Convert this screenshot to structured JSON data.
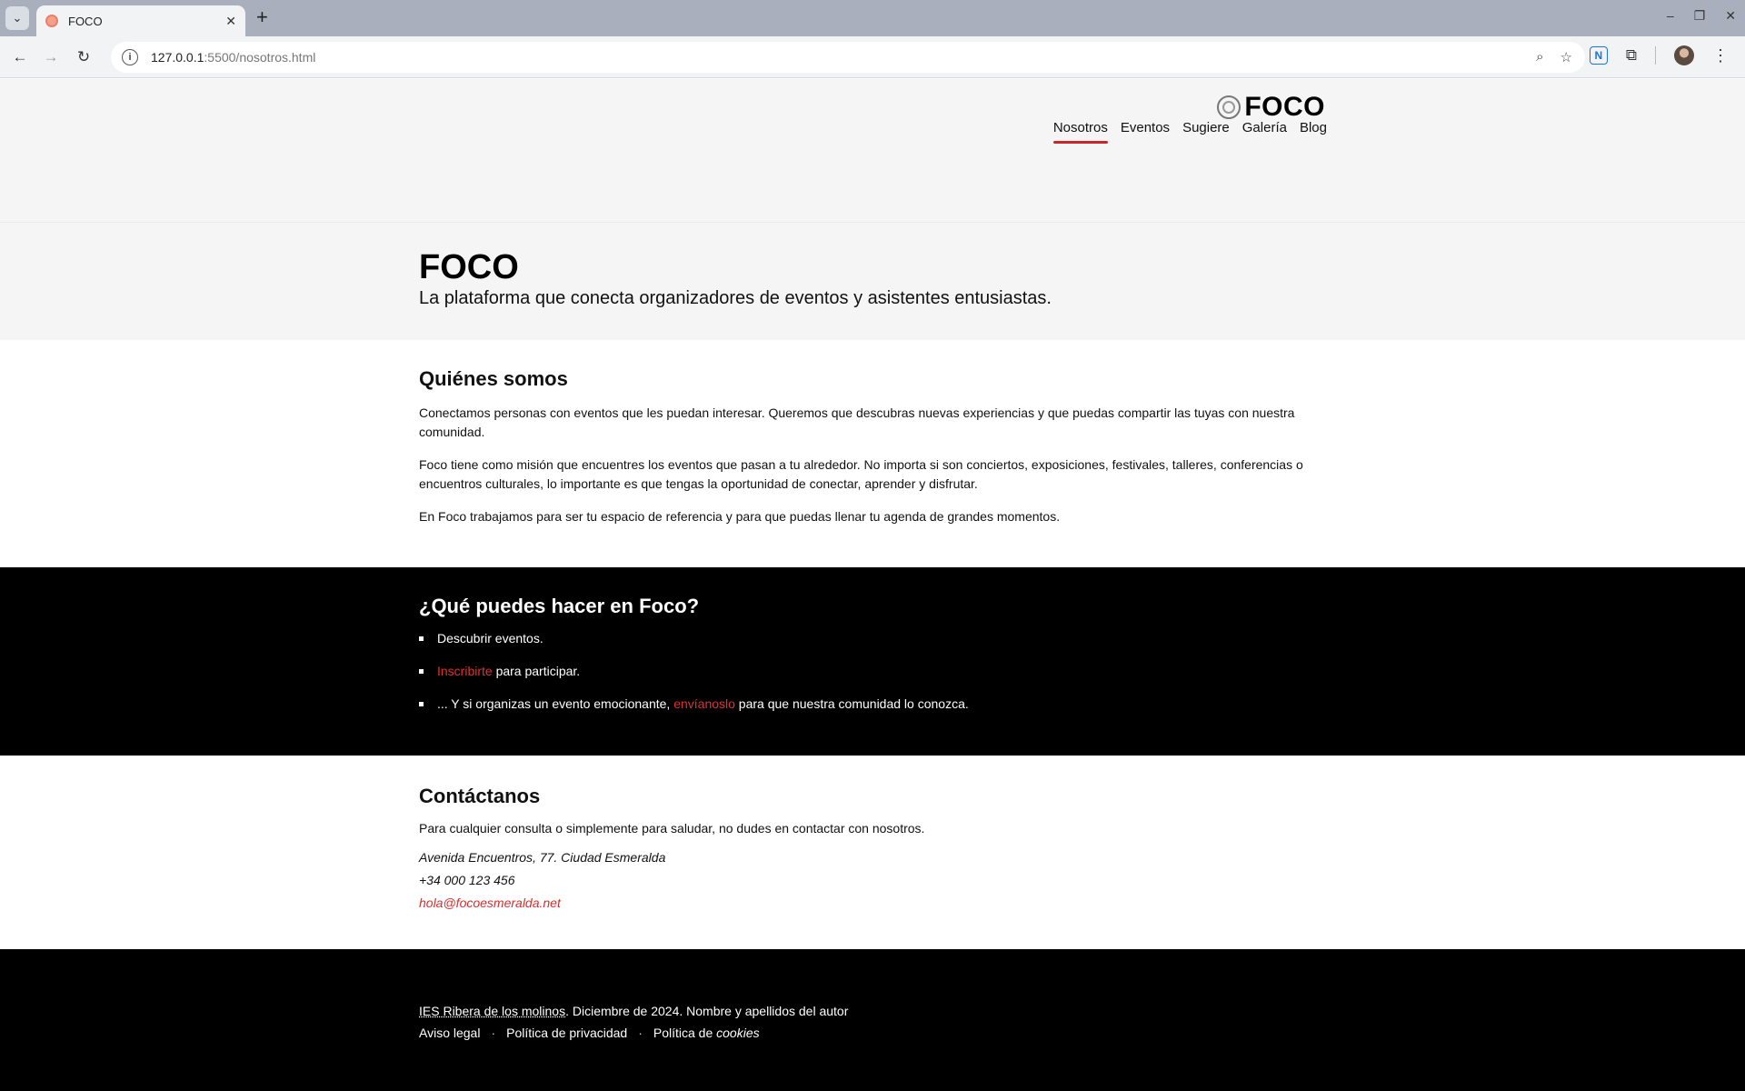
{
  "browser": {
    "tab_title": "FOCO",
    "new_tab_label": "+",
    "url_host": "127.0.0.1",
    "url_rest": ":5500/nosotros.html",
    "ext_n_label": "N"
  },
  "site": {
    "logo_text": "FOCO",
    "nav": [
      {
        "label": "Nosotros",
        "active": true
      },
      {
        "label": "Eventos"
      },
      {
        "label": "Sugiere"
      },
      {
        "label": "Galería"
      },
      {
        "label": "Blog"
      }
    ]
  },
  "hero": {
    "title": "FOCO",
    "subtitle": "La plataforma que conecta organizadores de eventos y asistentes entusiastas."
  },
  "about": {
    "heading": "Quiénes somos",
    "paragraphs": [
      "Conectamos personas con eventos que les puedan interesar. Queremos que descubras nuevas experiencias y que puedas compartir las tuyas con nuestra comunidad.",
      "Foco tiene como misión que encuentres los eventos que pasan a tu alrededor. No importa si son conciertos, exposiciones, festivales, talleres, conferencias o encuentros culturales, lo importante es que tengas la oportunidad de conectar, aprender y disfrutar.",
      "En Foco trabajamos para ser tu espacio de referencia y para que puedas llenar tu agenda de grandes momentos."
    ]
  },
  "features": {
    "heading": "¿Qué puedes hacer en Foco?",
    "item1": "Descubrir eventos.",
    "item2_link": "Inscribirte",
    "item2_rest": " para participar.",
    "item3_pre": "... Y si organizas un evento emocionante, ",
    "item3_link": "envíanoslo",
    "item3_rest": " para que nuestra comunidad lo conozca."
  },
  "contact": {
    "heading": "Contáctanos",
    "lead": "Para cualquier consulta o simplemente para saludar, no dudes en contactar con nosotros.",
    "address": "Avenida Encuentros, 77. Ciudad Esmeralda",
    "phone": "+34 000 123 456",
    "email": "hola@focoesmeralda.net"
  },
  "footer": {
    "school": "IES Ribera de los molinos",
    "credit_rest": ". Diciembre de 2024. Nombre y apellidos del autor",
    "legal": "Aviso legal",
    "privacy": "Política de privacidad",
    "cookies_pre": "Política de ",
    "cookies_em": "cookies",
    "separator": "·"
  },
  "colors": {
    "accent": "#d32f2f",
    "dark_band": "#000000",
    "light_band": "#f5f5f6"
  }
}
